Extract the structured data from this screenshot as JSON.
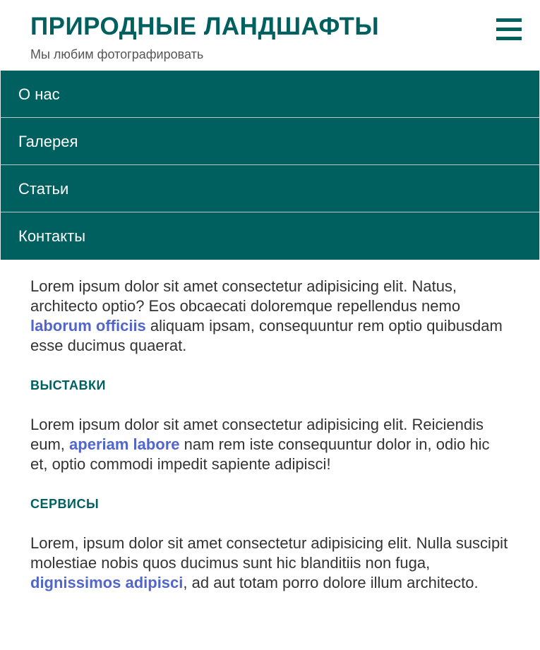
{
  "header": {
    "title": "ПРИРОДНЫЕ ЛАНДШАФТЫ",
    "subtitle": "Мы любим фотографировать",
    "menu_icon": "hamburger-icon"
  },
  "nav": {
    "items": [
      {
        "label": "О нас"
      },
      {
        "label": "Галерея"
      },
      {
        "label": "Статьи"
      },
      {
        "label": "Контакты"
      }
    ]
  },
  "content": {
    "intro": {
      "before": "Lorem ipsum dolor sit amet consectetur adipisicing elit. Natus, architecto optio? Eos obcaecati doloremque repellendus nemo ",
      "link": "laborum officiis",
      "after": " aliquam ipsam, consequuntur rem optio quibusdam esse ducimus quaerat."
    },
    "sections": [
      {
        "heading": "ВЫСТАВКИ",
        "before": "Lorem ipsum dolor sit amet consectetur adipisicing elit. Reiciendis eum, ",
        "link": "aperiam labore",
        "after": " nam rem iste consequuntur dolor in, odio hic et, optio commodi impedit sapiente adipisci!"
      },
      {
        "heading": "СЕРВИСЫ",
        "before": "Lorem, ipsum dolor sit amet consectetur adipisicing elit. Nulla suscipit molestiae nobis quos ducimus sunt hic blanditiis non fuga, ",
        "link": "dignissimos adipisci",
        "after": ", ad aut totam porro dolore illum architecto."
      }
    ]
  },
  "colors": {
    "brand": "#006060",
    "link": "#5066cc",
    "text": "#333333",
    "background": "#ffffff"
  }
}
